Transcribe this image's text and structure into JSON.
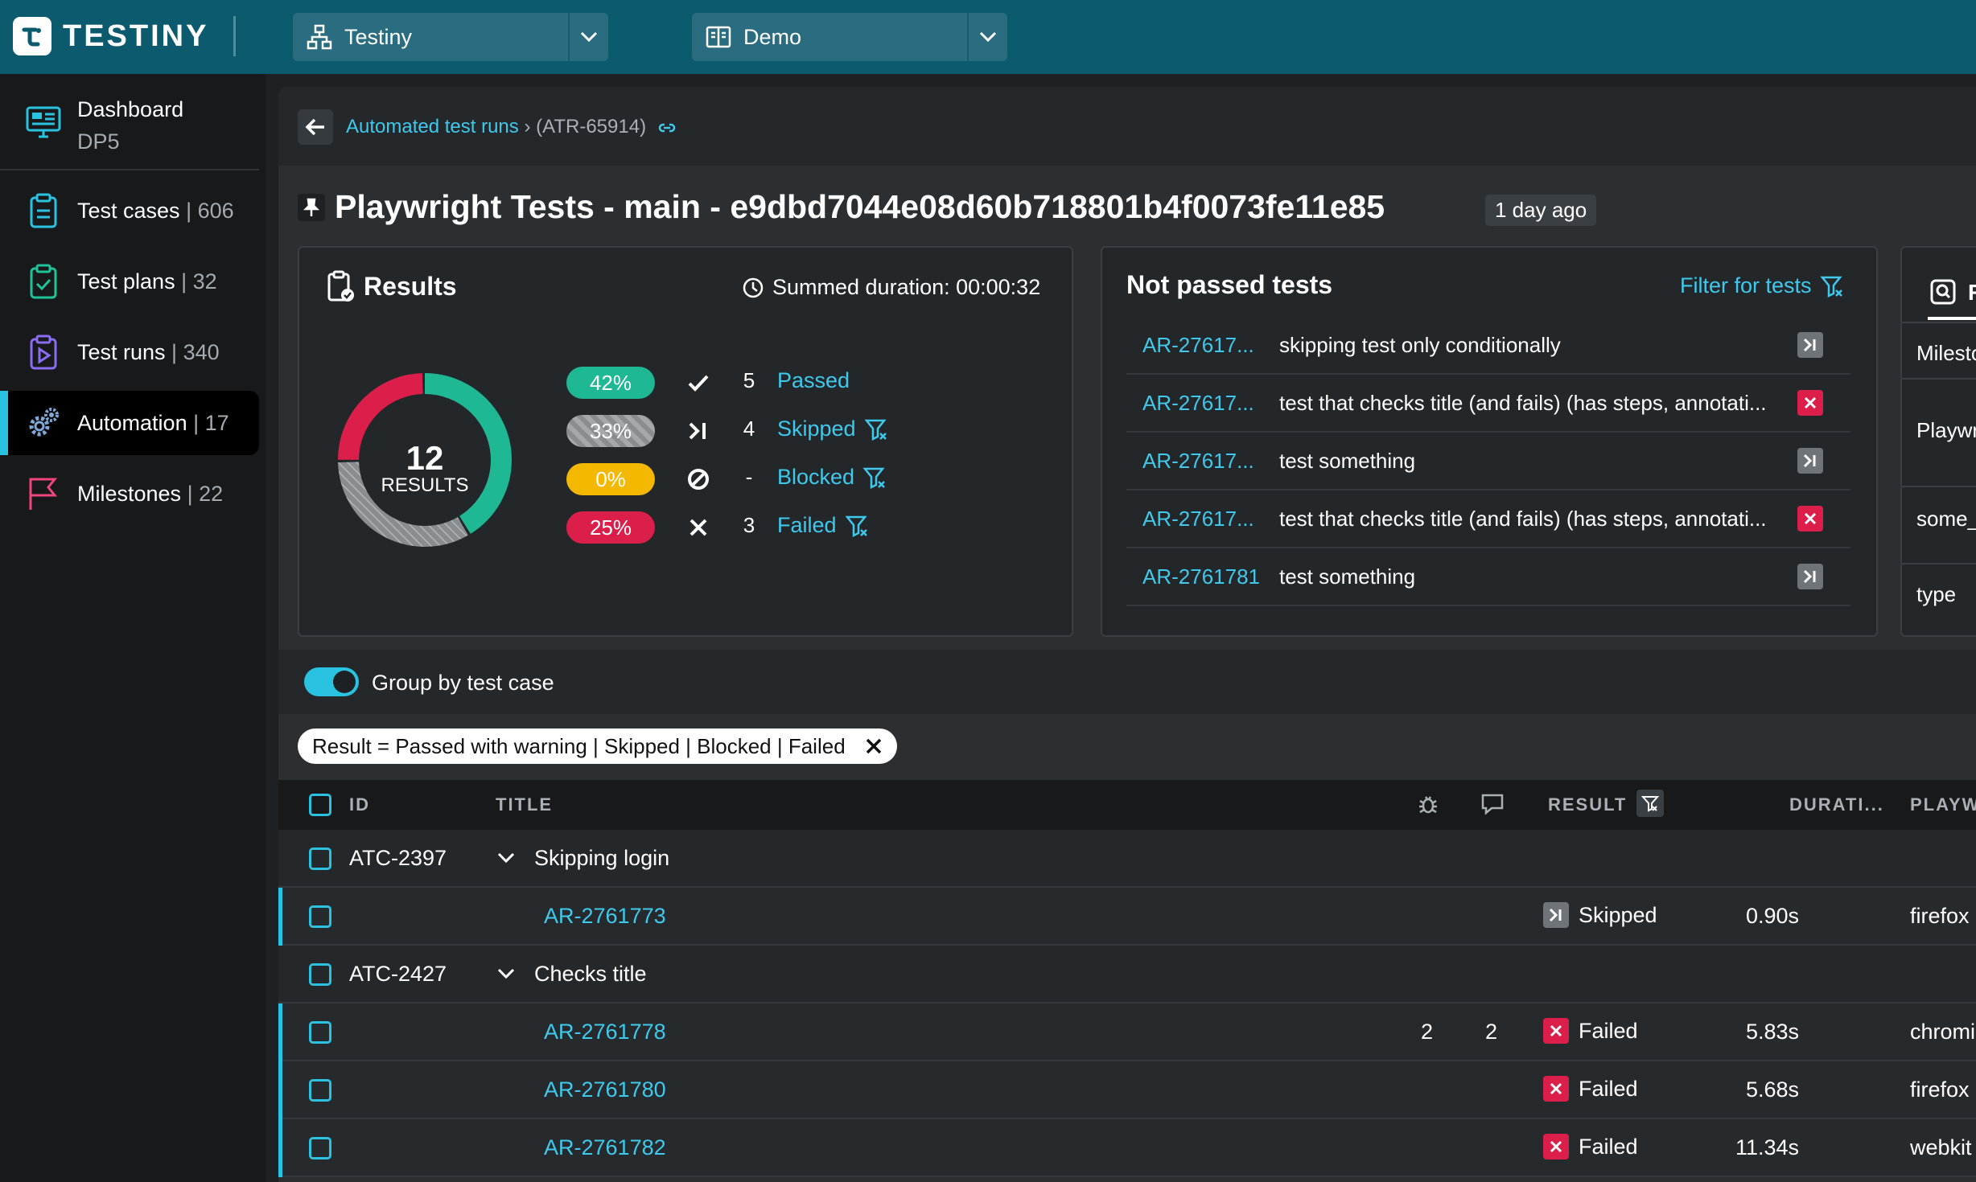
{
  "app": {
    "logo_text": "TESTINY"
  },
  "topbar": {
    "org_dropdown": "Testiny",
    "project_dropdown": "Demo"
  },
  "sidebar": {
    "dashboard": {
      "label": "Dashboard",
      "sub": "DP5"
    },
    "items": [
      {
        "label": "Test cases",
        "count": "606",
        "icon": "clipboard-icon"
      },
      {
        "label": "Test plans",
        "count": "32",
        "icon": "clipboard-check-icon"
      },
      {
        "label": "Test runs",
        "count": "340",
        "icon": "clipboard-play-icon"
      },
      {
        "label": "Automation",
        "count": "17",
        "icon": "gears-icon",
        "active": true
      },
      {
        "label": "Milestones",
        "count": "22",
        "icon": "flag-icon"
      }
    ]
  },
  "breadcrumb": {
    "link": "Automated test runs",
    "sep": "›",
    "current": "(ATR-65914)"
  },
  "page": {
    "title": "Playwright Tests - main - e9dbd7044e08d60b718801b4f0073fe11e85",
    "age": "1 day ago"
  },
  "results": {
    "title": "Results",
    "duration": "Summed duration: 00:00:32",
    "total": "12",
    "total_label": "RESULTS",
    "rows": [
      {
        "pct": "42%",
        "count": "5",
        "name": "Passed",
        "color": "#1fb894",
        "fraction": 0.4167
      },
      {
        "pct": "33%",
        "count": "4",
        "name": "Skipped",
        "color": "#8a8d90",
        "fraction": 0.3333
      },
      {
        "pct": "0%",
        "count": "-",
        "name": "Blocked",
        "color": "#f5b800",
        "fraction": 0
      },
      {
        "pct": "25%",
        "count": "3",
        "name": "Failed",
        "color": "#dc1f4a",
        "fraction": 0.25
      }
    ]
  },
  "not_passed": {
    "title": "Not passed tests",
    "filter_label": "Filter for tests",
    "rows": [
      {
        "id": "AR-27617...",
        "title": "skipping test only conditionally",
        "status": "skipped"
      },
      {
        "id": "AR-27617...",
        "title": "test that checks title (and fails) (has steps, annotati...",
        "status": "failed"
      },
      {
        "id": "AR-27617...",
        "title": "test something",
        "status": "skipped"
      },
      {
        "id": "AR-27617...",
        "title": "test that checks title (and fails) (has steps, annotati...",
        "status": "failed"
      },
      {
        "id": "AR-2761781",
        "title": "test something",
        "status": "skipped"
      }
    ]
  },
  "right_card": {
    "tab": "R",
    "rows": [
      "Milesto",
      "Playwr",
      "some_",
      "type"
    ]
  },
  "group_toggle": {
    "label": "Group by test case",
    "on": true
  },
  "filter_chip": {
    "label": "Result = Passed with warning | Skipped | Blocked | Failed"
  },
  "table": {
    "headers": {
      "id": "ID",
      "title": "TITLE",
      "result": "RESULT",
      "duration": "DURATI...",
      "playwright": "PLAYW"
    },
    "rows": [
      {
        "type": "group",
        "id": "ATC-2397",
        "title": "Skipping login"
      },
      {
        "type": "sub",
        "id": "AR-2761773",
        "bugs": "",
        "comments": "",
        "result": "Skipped",
        "status": "skipped",
        "duration": "0.90s",
        "browser": "firefox"
      },
      {
        "type": "group",
        "id": "ATC-2427",
        "title": "Checks title"
      },
      {
        "type": "sub",
        "id": "AR-2761778",
        "bugs": "2",
        "comments": "2",
        "result": "Failed",
        "status": "failed",
        "duration": "5.83s",
        "browser": "chromi"
      },
      {
        "type": "sub",
        "id": "AR-2761780",
        "bugs": "",
        "comments": "",
        "result": "Failed",
        "status": "failed",
        "duration": "5.68s",
        "browser": "firefox"
      },
      {
        "type": "sub",
        "id": "AR-2761782",
        "bugs": "",
        "comments": "",
        "result": "Failed",
        "status": "failed",
        "duration": "11.34s",
        "browser": "webkit"
      }
    ]
  }
}
